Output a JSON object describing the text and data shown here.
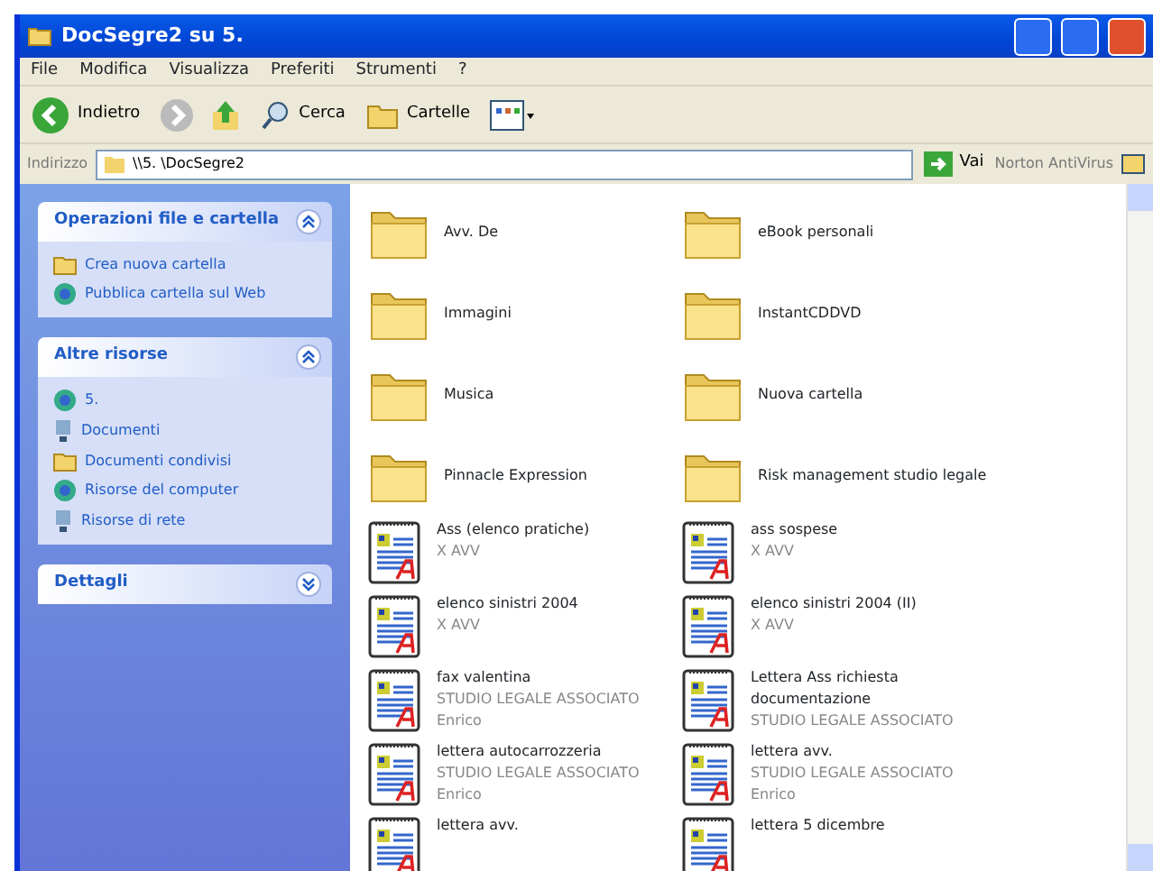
{
  "window": {
    "title": "DocSegre2 su 5."
  },
  "menu": [
    "File",
    "Modifica",
    "Visualizza",
    "Preferiti",
    "Strumenti",
    "?"
  ],
  "toolbar": {
    "back": "Indietro",
    "search": "Cerca",
    "folders": "Cartelle"
  },
  "address_bar": {
    "label": "Indirizzo",
    "value": "\\\\5.          \\DocSegre2",
    "go": "Vai",
    "norton": "Norton AntiVirus"
  },
  "sidebar": [
    {
      "title": "Operazioni file e cartella",
      "expanded": true,
      "items": [
        "Crea nuova cartella",
        "Pubblica cartella sul Web"
      ]
    },
    {
      "title": "Altre risorse",
      "expanded": true,
      "items": [
        "5.",
        "Documenti",
        "Documenti condivisi",
        "Risorse del computer",
        "Risorse di rete"
      ]
    },
    {
      "title": "Dettagli",
      "expanded": false
    }
  ],
  "files": [
    {
      "kind": "folder",
      "name": "Avv. De"
    },
    {
      "kind": "folder",
      "name": "eBook personali"
    },
    {
      "kind": "folder",
      "name": "Immagini"
    },
    {
      "kind": "folder",
      "name": "InstantCDDVD"
    },
    {
      "kind": "folder",
      "name": "Musica"
    },
    {
      "kind": "folder",
      "name": "Nuova cartella"
    },
    {
      "kind": "folder",
      "name": "Pinnacle Expression"
    },
    {
      "kind": "folder",
      "name": "Risk management studio legale"
    },
    {
      "kind": "document",
      "name": "Ass        (elenco pratiche)",
      "details": [
        "X  AVV"
      ]
    },
    {
      "kind": "document",
      "name": "ass        sospese",
      "details": [
        "X  AVV"
      ]
    },
    {
      "kind": "document",
      "name": "elenco sinistri 2004",
      "details": [
        "X  AVV"
      ]
    },
    {
      "kind": "document",
      "name": "elenco sinistri 2004 (II)",
      "details": [
        "X  AVV"
      ]
    },
    {
      "kind": "document",
      "name": "fax         valentina",
      "details": [
        "STUDIO LEGALE ASSOCIATO",
        "Enrico"
      ]
    },
    {
      "kind": "document",
      "name": "Lettera Ass        richiesta documentazione",
      "details": [
        "STUDIO LEGALE ASSOCIATO"
      ]
    },
    {
      "kind": "document",
      "name": "lettera autocarrozzeria",
      "details": [
        "STUDIO LEGALE ASSOCIATO",
        "Enrico"
      ]
    },
    {
      "kind": "document",
      "name": "lettera avv.",
      "details": [
        "STUDIO LEGALE ASSOCIATO",
        "Enrico"
      ]
    },
    {
      "kind": "document",
      "name": "lettera avv."
    },
    {
      "kind": "document",
      "name": "lettera              5 dicembre"
    }
  ]
}
